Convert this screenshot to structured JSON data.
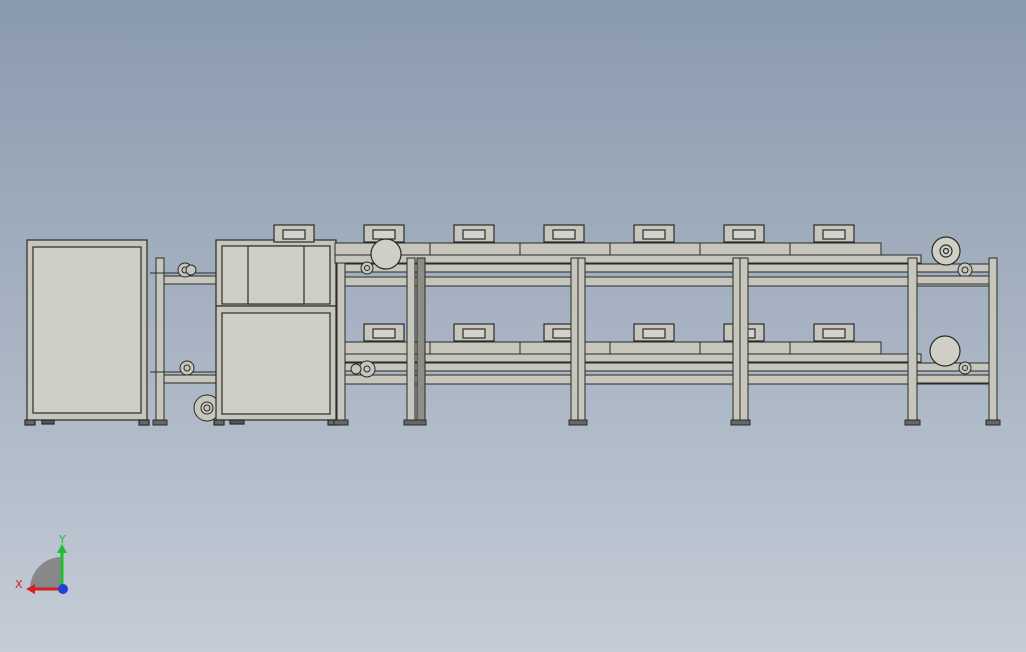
{
  "viewport": {
    "background_top": "#8a9aae",
    "background_bottom": "#c4ccd6",
    "model_line_color": "#2a2a2a",
    "model_fill_color": "#c6c6bc",
    "model_panel_color": "#cfcfc5"
  },
  "triad": {
    "x_label": "X",
    "y_label": "Y",
    "x_color": "#d61f1f",
    "y_color": "#1fbf2f",
    "z_color": "#1f3fd6"
  }
}
